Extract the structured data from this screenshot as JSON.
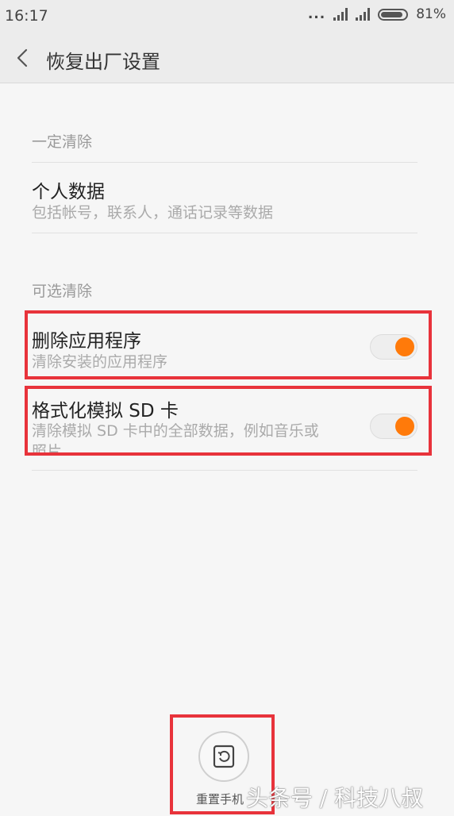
{
  "status_bar": {
    "time": "16:17",
    "dots": "...",
    "battery_percent": "81%"
  },
  "header": {
    "title": "恢复出厂设置"
  },
  "sections": [
    {
      "label": "一定清除",
      "items": [
        {
          "title": "个人数据",
          "subtitle": "包括帐号，联系人，通话记录等数据"
        }
      ]
    },
    {
      "label": "可选清除",
      "items": [
        {
          "title": "删除应用程序",
          "subtitle": "清除安装的应用程序",
          "toggle_on": true
        },
        {
          "title": "格式化模拟 SD 卡",
          "subtitle_line1": "清除模拟 SD 卡中的全部数据，例如音乐或",
          "subtitle_line2": "照片",
          "toggle_on": true
        }
      ]
    }
  ],
  "footer": {
    "reset_label": "重置手机"
  },
  "watermark": "头条号 / 科技八叔",
  "colors": {
    "accent": "#ff7a0a",
    "highlight": "#e8333b"
  }
}
